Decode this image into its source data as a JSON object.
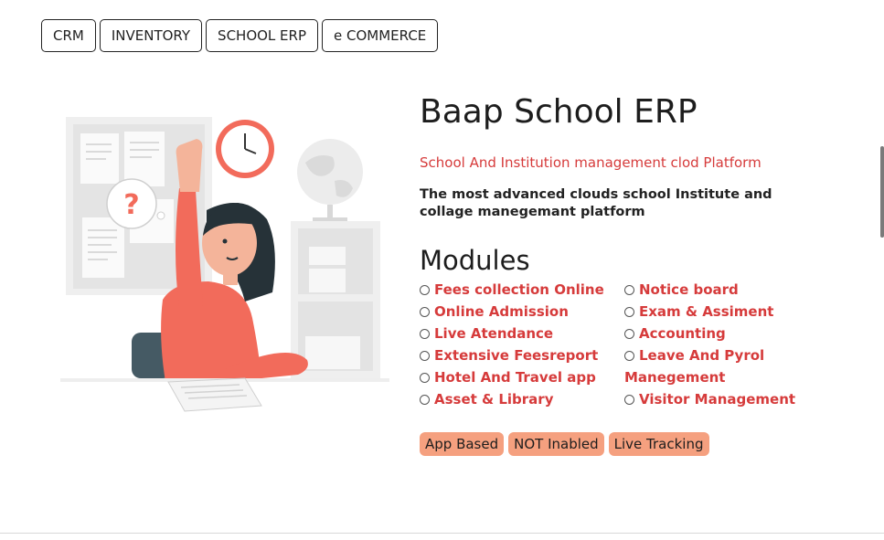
{
  "tabs": [
    {
      "label": "CRM"
    },
    {
      "label": "INVENTORY"
    },
    {
      "label": "SCHOOL ERP"
    },
    {
      "label": "e COMMERCE"
    }
  ],
  "product": {
    "title": "Baap School ERP",
    "subtitle": "School And Institution management clod Platform",
    "description": "The most advanced clouds school Institute and collage manegemant platform"
  },
  "modules": {
    "title": "Modules",
    "left": [
      {
        "label": "Fees collection Online"
      },
      {
        "label": "Online Admission"
      },
      {
        "label": "Live Atendance"
      },
      {
        "label": "Extensive Feesreport"
      },
      {
        "label": "Hotel And Travel app"
      },
      {
        "label": "Asset & Library"
      }
    ],
    "right": [
      {
        "label": "Notice board"
      },
      {
        "label": "Exam & Assiment"
      },
      {
        "label": "Accounting"
      },
      {
        "label": "Leave And Pyrol Manegement"
      },
      {
        "label": "Visitor Management"
      }
    ]
  },
  "badges": [
    {
      "label": "App Based"
    },
    {
      "label": "NOT Inabled"
    },
    {
      "label": "Live Tracking"
    }
  ],
  "illustration": {
    "question_mark": "?",
    "colors": {
      "accent": "#f26b5b",
      "hair": "#263238",
      "skin": "#f4b49a"
    }
  },
  "colors": {
    "accent_text": "#d63b3b",
    "badge_bg": "#f5a07f"
  }
}
